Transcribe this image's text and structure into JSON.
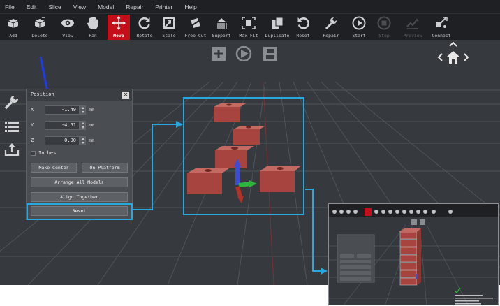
{
  "menubar": {
    "items": [
      "File",
      "Edit",
      "Slice",
      "View",
      "Model",
      "Repair",
      "Printer",
      "Help"
    ]
  },
  "toolbar": {
    "buttons": [
      {
        "label": "Add",
        "icon": "add-icon",
        "state": "normal"
      },
      {
        "label": "Delete",
        "icon": "delete-icon",
        "state": "normal"
      },
      {
        "label": "View",
        "icon": "view-icon",
        "state": "normal"
      },
      {
        "label": "Pan",
        "icon": "pan-icon",
        "state": "normal"
      },
      {
        "label": "Move",
        "icon": "move-icon",
        "state": "active"
      },
      {
        "label": "Rotate",
        "icon": "rotate-icon",
        "state": "normal"
      },
      {
        "label": "Scale",
        "icon": "scale-icon",
        "state": "normal"
      },
      {
        "label": "Free Cut",
        "icon": "free-cut-icon",
        "state": "normal"
      },
      {
        "label": "Support",
        "icon": "support-icon",
        "state": "normal"
      },
      {
        "label": "Max Fit",
        "icon": "max-fit-icon",
        "state": "normal"
      },
      {
        "label": "Duplicate",
        "icon": "duplicate-icon",
        "state": "normal"
      },
      {
        "label": "Reset",
        "icon": "reset-icon",
        "state": "normal"
      },
      {
        "label": "Repair",
        "icon": "repair-icon",
        "state": "normal"
      },
      {
        "label": "Start",
        "icon": "start-icon",
        "state": "normal"
      },
      {
        "label": "Stop",
        "icon": "stop-icon",
        "state": "disabled"
      },
      {
        "label": "Preview",
        "icon": "preview-icon",
        "state": "disabled"
      },
      {
        "label": "Connect",
        "icon": "connect-icon",
        "state": "normal"
      }
    ]
  },
  "panel": {
    "title": "Position",
    "x": {
      "axis": "X",
      "value": "-1.49",
      "unit": "mm"
    },
    "y": {
      "axis": "Y",
      "value": "-4.51",
      "unit": "mm"
    },
    "z": {
      "axis": "Z",
      "value": "0.00",
      "unit": "mm"
    },
    "inches_label": "Inches",
    "inches_checked": false,
    "make_center": "Make Center",
    "on_platform": "On Platform",
    "arrange_all": "Arrange All Models",
    "align_together": "Align Together",
    "reset": "Reset"
  },
  "colors": {
    "active_tool": "#c40f1b",
    "highlight": "#29a8e0",
    "model": "#a8443f",
    "toolbar_bg": "#1e2024",
    "viewport_bg": "#363a3f"
  }
}
